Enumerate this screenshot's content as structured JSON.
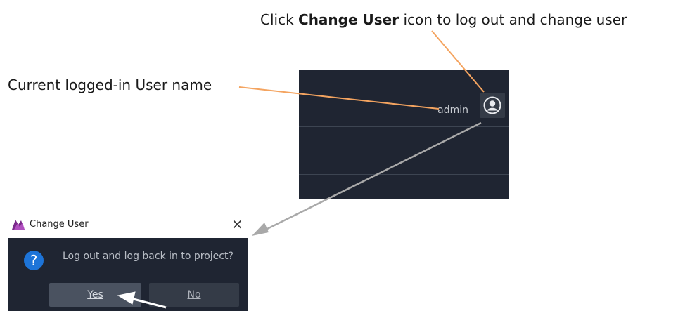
{
  "callouts": {
    "top_prefix": "Click ",
    "top_bold": "Change User",
    "top_suffix": " icon to log out and change user",
    "left": "Current logged-in User name"
  },
  "toolbar": {
    "username": "admin",
    "user_icon": "user-icon"
  },
  "dialog": {
    "title": "Change User",
    "close_glyph": "×",
    "question_glyph": "?",
    "message": "Log out and log back in to project?",
    "yes_label": "Yes",
    "no_label": "No"
  },
  "colors": {
    "callout_line": "#f4a460",
    "arrow_gray": "#a9a9a9",
    "dark_panel": "#1f2532",
    "accent_blue": "#1d74d8"
  }
}
